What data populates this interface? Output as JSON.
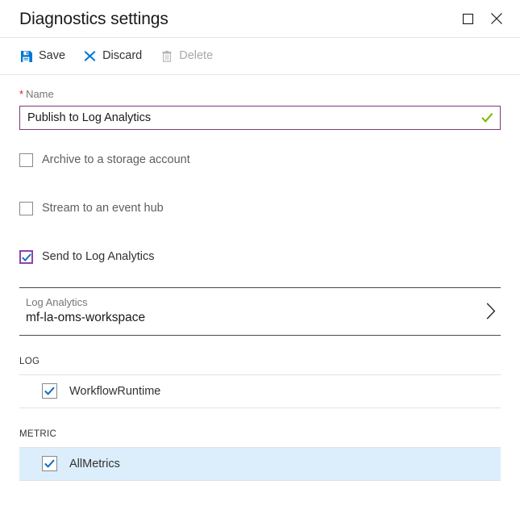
{
  "window": {
    "title": "Diagnostics settings",
    "maximize_icon": "maximize-icon",
    "close_icon": "close-icon"
  },
  "toolbar": {
    "save_label": "Save",
    "save_icon": "save-floppy-icon",
    "discard_label": "Discard",
    "discard_icon": "discard-x-icon",
    "delete_label": "Delete",
    "delete_icon": "delete-trash-icon",
    "delete_disabled": true
  },
  "name_field": {
    "required_marker": "*",
    "label": "Name",
    "value": "Publish to Log Analytics",
    "placeholder": "",
    "valid_icon": "green-check-icon",
    "border_color": "#7a3b7a",
    "valid_color": "#7cbb00"
  },
  "destinations": [
    {
      "label": "Archive to a storage account",
      "checked": false,
      "focused": false
    },
    {
      "label": "Stream to an event hub",
      "checked": false,
      "focused": false
    },
    {
      "label": "Send to Log Analytics",
      "checked": true,
      "focused": true
    }
  ],
  "workspace_picker": {
    "caption": "Log Analytics",
    "value": "mf-la-oms-workspace",
    "chevron_icon": "chevron-right-icon"
  },
  "log_section": {
    "title": "LOG",
    "rows": [
      {
        "label": "WorkflowRuntime",
        "checked": true,
        "highlighted": false
      }
    ]
  },
  "metric_section": {
    "title": "METRIC",
    "rows": [
      {
        "label": "AllMetrics",
        "checked": true,
        "highlighted": true
      }
    ]
  },
  "colors": {
    "accent_blue": "#0078d4",
    "check_blue": "#0f6cbd",
    "focus_purple": "#8e44ad",
    "highlight_blue": "#dceefc",
    "required_red": "#e81123"
  }
}
